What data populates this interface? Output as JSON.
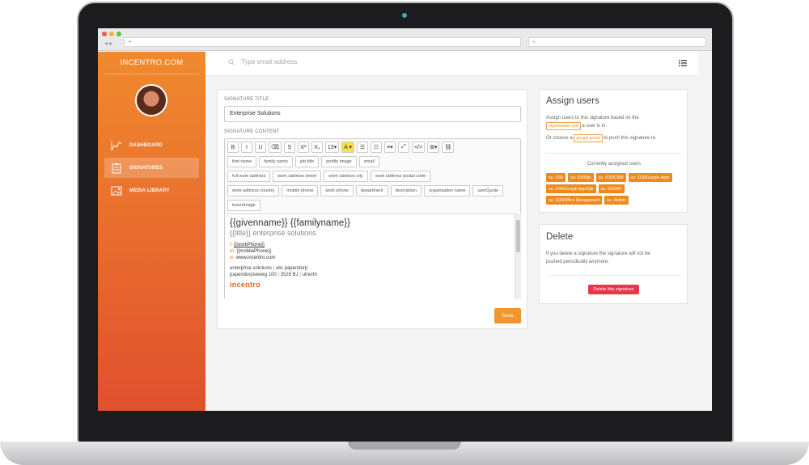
{
  "browser": {
    "nav": "◂ ▸",
    "url_placeholder": "+",
    "search_placeholder": "⌕"
  },
  "sidebar": {
    "brand": "INCENTRO.COM",
    "items": [
      {
        "label": "DASHBOARD",
        "icon": "trend-line-icon"
      },
      {
        "label": "SIGNATURES",
        "icon": "clipboard-icon"
      },
      {
        "label": "MEDIA LIBRARY",
        "icon": "image-icon"
      }
    ]
  },
  "topbar": {
    "search_placeholder": "Type email address"
  },
  "signature": {
    "title_label": "SIGNATURE TITLE",
    "title_value": "Enterprise Solutions",
    "content_label": "SIGNATURE CONTENT",
    "toolbar": [
      "B",
      "I",
      "U",
      "⌫",
      "S",
      "X²",
      "X₂",
      "13▾",
      "A ▾",
      "☰",
      "☷",
      "≡▾",
      "⤢",
      "</>",
      "⊞▾",
      "⛓"
    ],
    "tags_row1": [
      "first name",
      "family name",
      "job title",
      "profile image",
      "email"
    ],
    "tags_row2": [
      "full work address",
      "work address street",
      "work address city",
      "work address postal code"
    ],
    "tags_row3": [
      "work address country",
      "mobile phone",
      "work phone",
      "department",
      "description",
      "organisation name",
      "userQuote"
    ],
    "tags_row4": [
      "insertImage"
    ],
    "preview": {
      "name_line": "{{givenname}} {{familyname}}",
      "title_line": "{{title}} enterprise solutions",
      "t_label": "t:",
      "t_value": "{{workPhone}}",
      "m_label": "m:",
      "m_value": "{{mobilePhone}}",
      "w_label": "w:",
      "w_value": "www.incentro.com",
      "addr1_a": "enterprise solutions",
      "addr1_b": "wtc papendorp",
      "addr2_a": "papendorpseweg 100",
      "addr2_b": "3528 BJ",
      "addr2_c": "utrecht",
      "logo_text": "incentro"
    },
    "save_label": "Save"
  },
  "assign": {
    "title": "Assign users",
    "line1_a": "Assign users to this signature based on the",
    "line1_tag": "organisation unit",
    "line1_b": "a user is in.",
    "line2_a": "Or choose a",
    "line2_tag": "google group",
    "line2_b": "to push this signature to.",
    "currently": "Currently assigned users",
    "users": [
      "ou: /030",
      "ou: /030/ijts",
      "ou: /030/CRM",
      "ou: /030/Google Apps",
      "ou: /030/Google Apps/ijts",
      "ou: /030/MT",
      "ou: /030/Office Management",
      "ou: /Admin"
    ]
  },
  "delete": {
    "title": "Delete",
    "text1": "If you delete a signature the signature will not be",
    "text2": "pushed periodically anymore.",
    "button": "Delete this signature"
  },
  "colors": {
    "accent": "#f0962a",
    "danger": "#e8364a"
  }
}
